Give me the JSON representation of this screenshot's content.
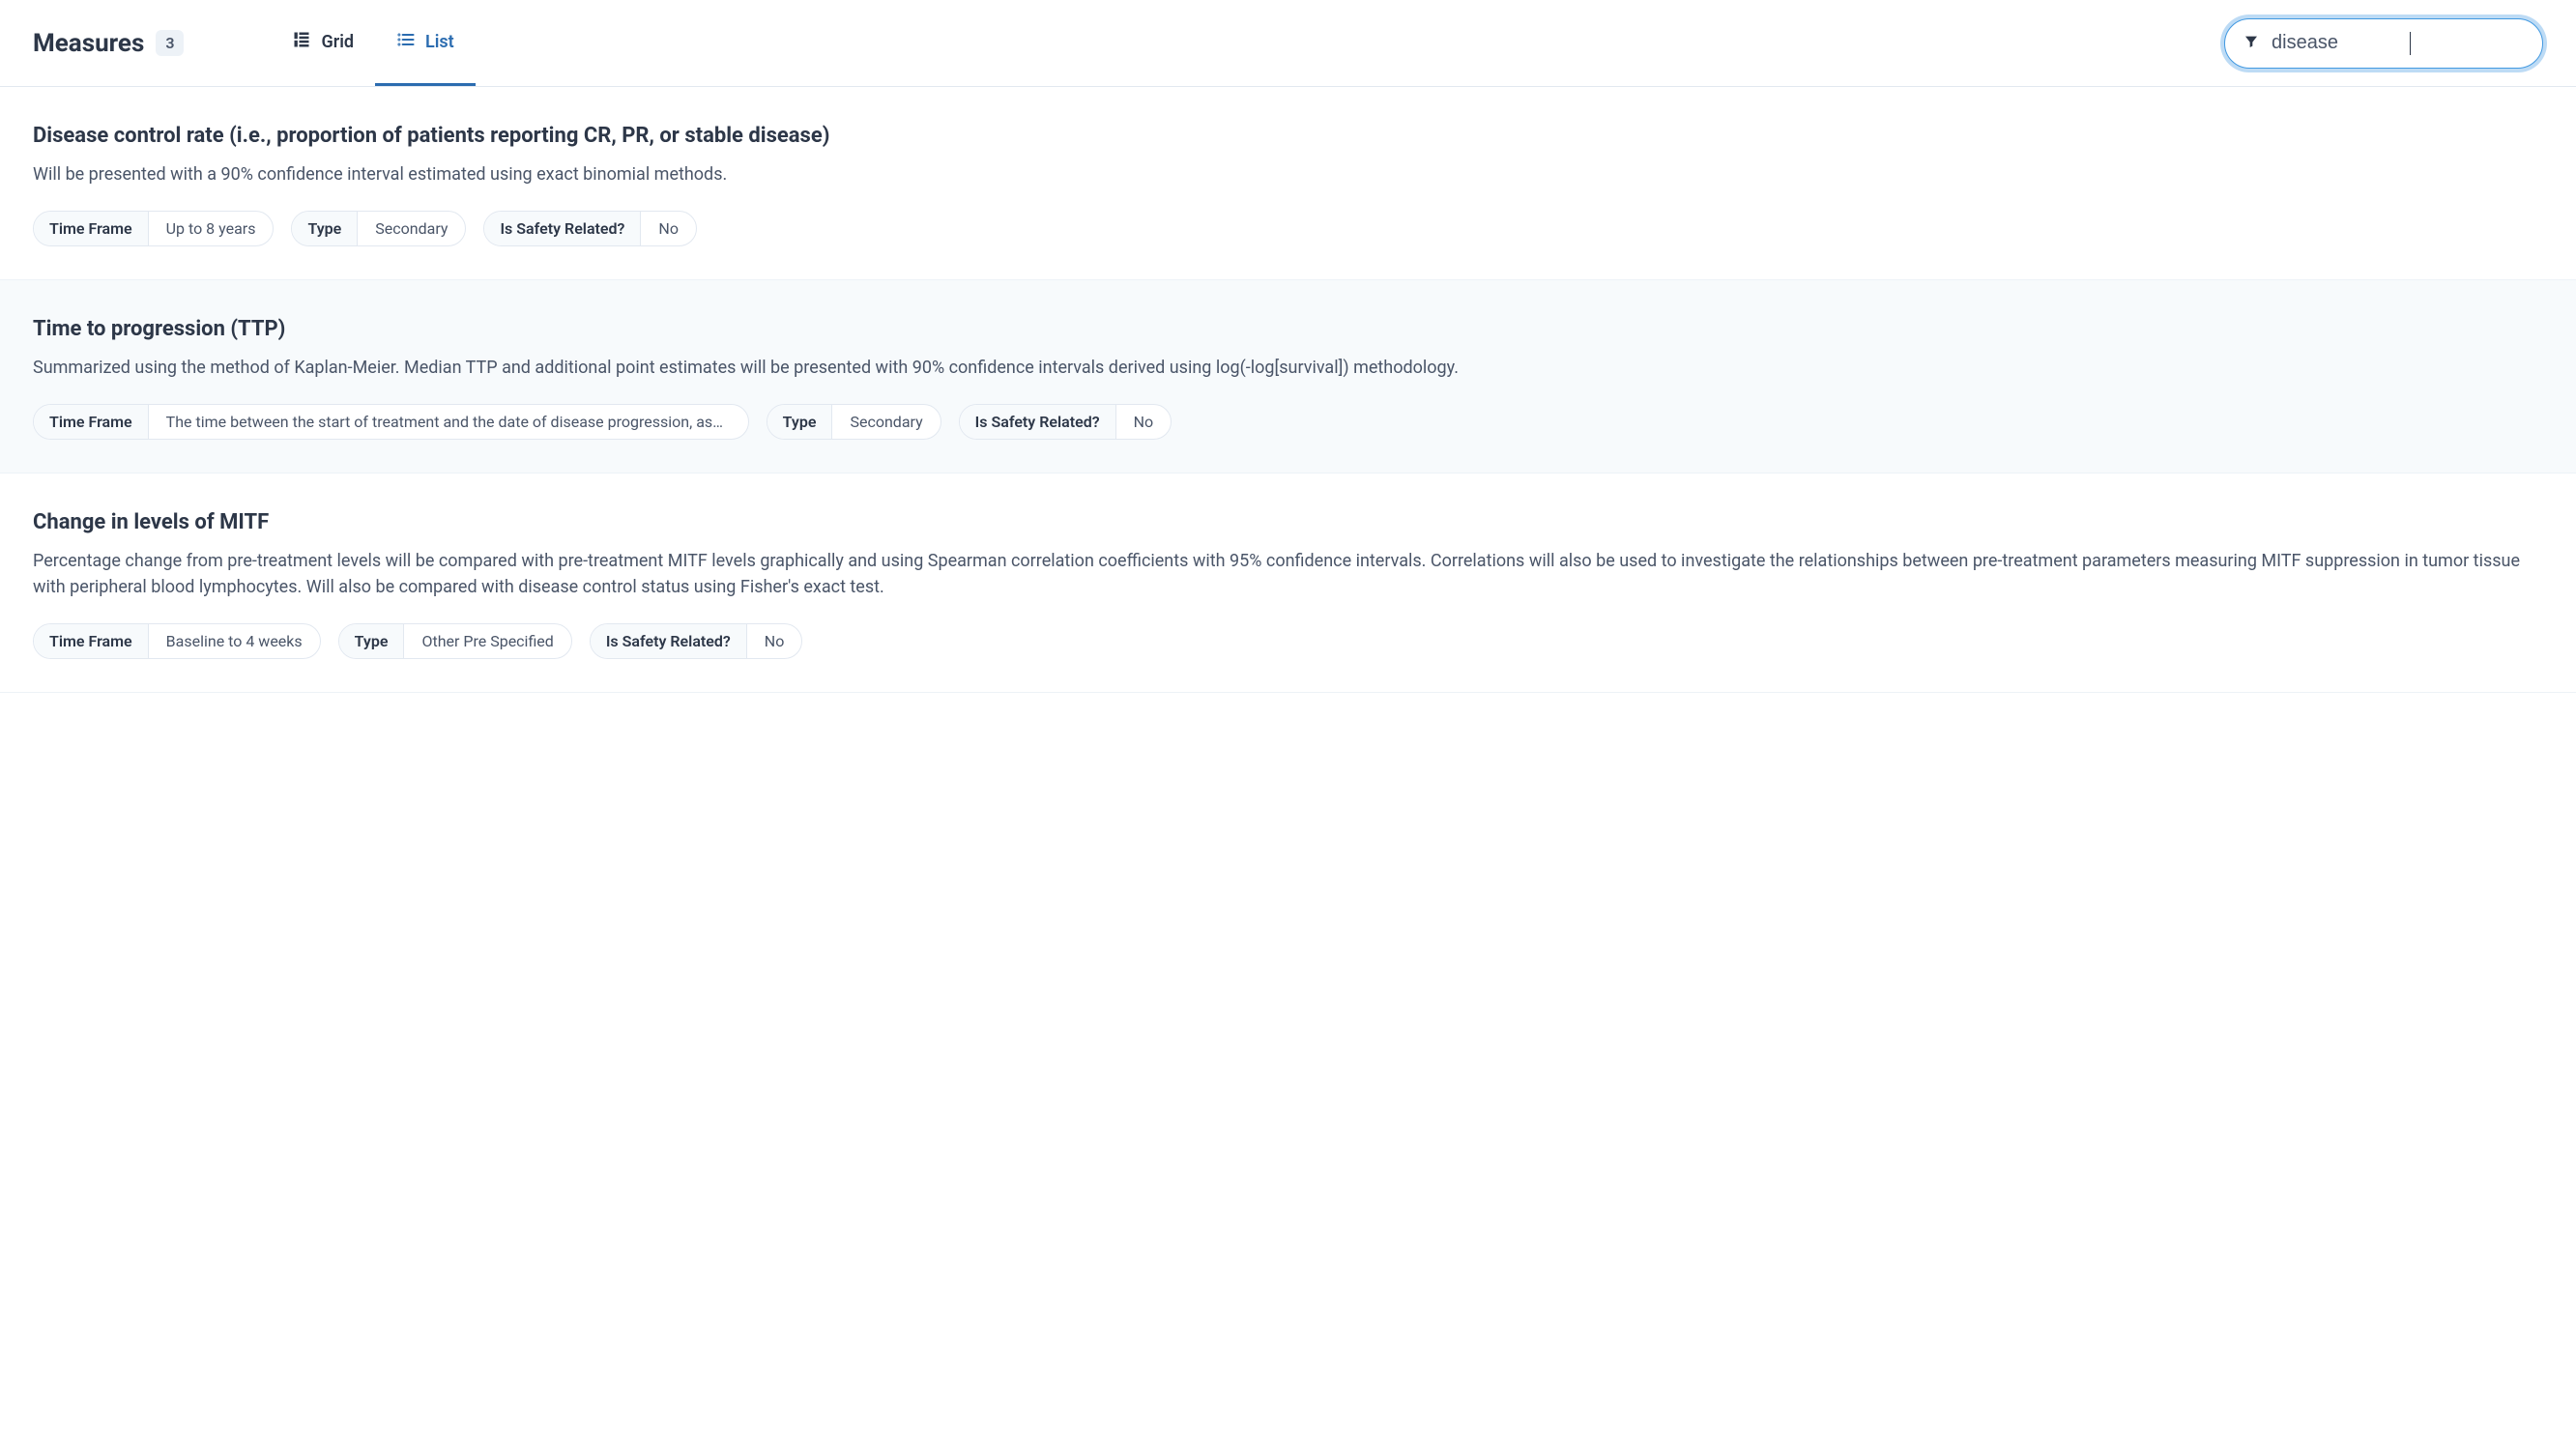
{
  "header": {
    "title": "Measures",
    "count": "3",
    "tabs": {
      "grid": "Grid",
      "list": "List"
    },
    "search_value": "disease"
  },
  "labels": {
    "time_frame": "Time Frame",
    "type": "Type",
    "safety": "Is Safety Related?"
  },
  "items": [
    {
      "title": "Disease control rate (i.e., proportion of patients reporting CR, PR, or stable disease)",
      "description": "Will be presented with a 90% confidence interval estimated using exact binomial methods.",
      "time_frame": "Up to 8 years",
      "type": "Secondary",
      "safety": "No"
    },
    {
      "title": "Time to progression (TTP)",
      "description": "Summarized using the method of Kaplan-Meier. Median TTP and additional point estimates will be presented with 90% confidence intervals derived using log(-log[survival]) methodology.",
      "time_frame": "The time between the start of treatment and the date of disease progression, assessed up t...",
      "type": "Secondary",
      "safety": "No"
    },
    {
      "title": "Change in levels of MITF",
      "description": "Percentage change from pre-treatment levels will be compared with pre-treatment MITF levels graphically and using Spearman correlation coefficients with 95% confidence intervals. Correlations will also be used to investigate the relationships between pre-treatment parameters measuring MITF suppression in tumor tissue with peripheral blood lymphocytes. Will also be compared with disease control status using Fisher's exact test.",
      "time_frame": "Baseline to 4 weeks",
      "type": "Other Pre Specified",
      "safety": "No"
    }
  ]
}
